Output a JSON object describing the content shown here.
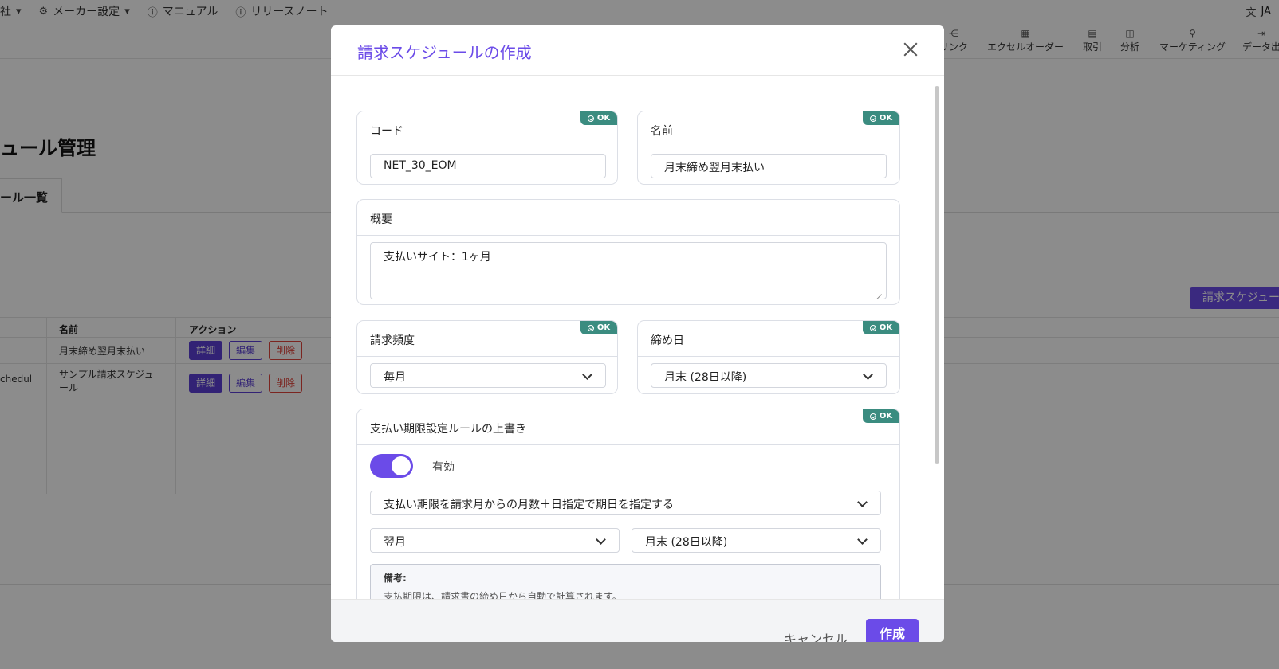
{
  "topnav": {
    "items": [
      {
        "label": "社",
        "icon": "chevron-down-icon"
      },
      {
        "label": "メーカー設定",
        "icon": "gear-icon"
      },
      {
        "label": "マニュアル",
        "icon": "help-circle-icon"
      },
      {
        "label": "リリースノート",
        "icon": "info-icon"
      }
    ],
    "lang": "JA"
  },
  "toolbar": {
    "items": [
      {
        "label": "リンク",
        "icon": "share-icon"
      },
      {
        "label": "エクセルオーダー",
        "icon": "spreadsheet-icon"
      },
      {
        "label": "取引",
        "icon": "message-icon"
      },
      {
        "label": "分析",
        "icon": "chart-icon"
      },
      {
        "label": "マーケティング",
        "icon": "broadcast-icon"
      },
      {
        "label": "データ出",
        "icon": "export-icon"
      }
    ]
  },
  "page": {
    "title": "ュール管理",
    "tab": "ール一覧",
    "create_button": "請求スケジュー"
  },
  "table": {
    "headers": [
      "名前",
      "アクション"
    ],
    "rows": [
      {
        "id": "",
        "name": "月末締め翌月末払い"
      },
      {
        "id": "chedul",
        "name": "サンプル請求スケジュ\nール"
      }
    ],
    "actions": {
      "detail": "詳細",
      "edit": "編集",
      "delete": "削除"
    }
  },
  "modal": {
    "title": "請求スケジュールの作成",
    "ok_badge": "OK",
    "code": {
      "label": "コード",
      "value": "NET_30_EOM"
    },
    "name": {
      "label": "名前",
      "value": "月末締め翌月末払い"
    },
    "summary": {
      "label": "概要",
      "value": "支払いサイト：1ヶ月"
    },
    "frequency": {
      "label": "請求頻度",
      "value": "毎月"
    },
    "closing_day": {
      "label": "締め日",
      "value": "月末 (28日以降)"
    },
    "due_rule": {
      "label": "支払い期限設定ルールの上書き",
      "toggle_label": "有効",
      "enabled": true,
      "method": "支払い期限を請求月からの月数＋日指定で期日を指定する",
      "month": "翌月",
      "day": "月末 (28日以降)",
      "note_title": "備考:",
      "note_text": "支払期限は、請求書の締め日から自動で計算されます。"
    },
    "cancel": "キャンセル",
    "submit": "作成"
  },
  "colors": {
    "accent": "#6b4be8",
    "ok_badge": "#3b8c80",
    "danger": "#e0443b"
  }
}
